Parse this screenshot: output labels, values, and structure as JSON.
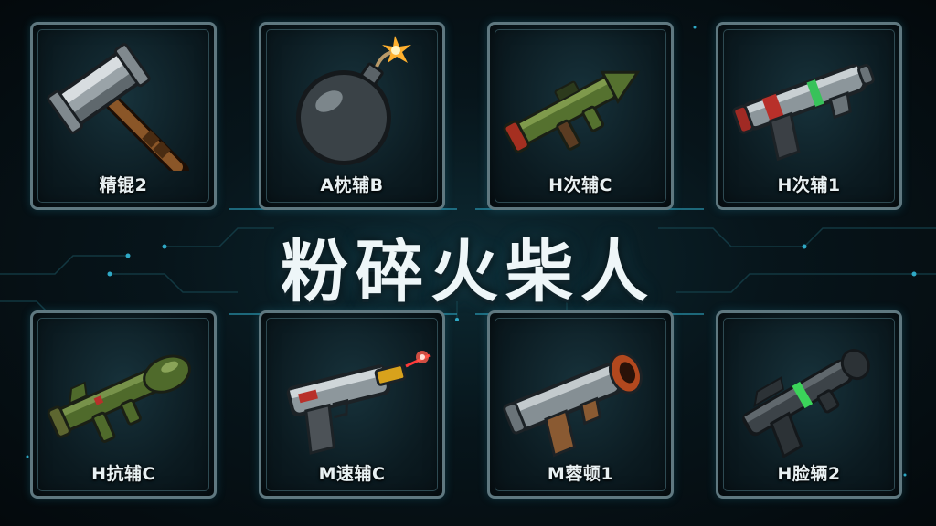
{
  "title": "粉碎火柴人",
  "colors": {
    "accent": "#3fb6d0",
    "frame": "#5f7880",
    "text": "#e8f0f2"
  },
  "weapons": [
    {
      "label": "精锟2",
      "icon": "hammer-icon"
    },
    {
      "label": "A枕辅B",
      "icon": "bomb-icon"
    },
    {
      "label": "H次辅C",
      "icon": "bazooka-icon"
    },
    {
      "label": "H次辅1",
      "icon": "ray-gun-icon"
    },
    {
      "label": "H抗辅C",
      "icon": "rocket-launcher-icon"
    },
    {
      "label": "M速辅C",
      "icon": "laser-pistol-icon"
    },
    {
      "label": "M蓉顿1",
      "icon": "cannon-gun-icon"
    },
    {
      "label": "H脸辆2",
      "icon": "plasma-rifle-icon"
    }
  ]
}
